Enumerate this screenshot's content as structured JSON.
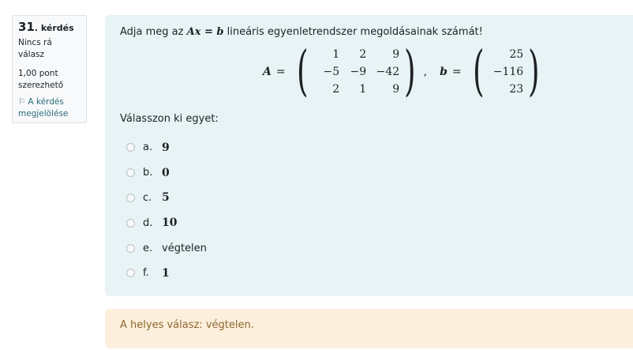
{
  "info": {
    "number": "31",
    "number_label": ". kérdés",
    "state": "Nincs rá válasz",
    "grade": "1,00 pont szerezhető",
    "flag_label": "A kérdés megjelölése"
  },
  "question": {
    "text_before": "Adja meg az",
    "math_inline": "Ax = b",
    "text_after": "lineáris egyenletrendszer megoldásainak számát!",
    "matrix_A_name": "A",
    "matrix_A": [
      [
        "1",
        "2",
        "9"
      ],
      [
        "−5",
        "−9",
        "−42"
      ],
      [
        "2",
        "1",
        "9"
      ]
    ],
    "vector_b_name": "b",
    "vector_b": [
      "25",
      "−116",
      "23"
    ],
    "prompt": "Válasszon ki egyet:"
  },
  "answers": [
    {
      "letter": "a.",
      "value": "9"
    },
    {
      "letter": "b.",
      "value": "0"
    },
    {
      "letter": "c.",
      "value": "5"
    },
    {
      "letter": "d.",
      "value": "10"
    },
    {
      "letter": "e.",
      "value": "végtelen"
    },
    {
      "letter": "f.",
      "value": "1"
    }
  ],
  "feedback": {
    "text": "A helyes válasz: végtelen."
  }
}
